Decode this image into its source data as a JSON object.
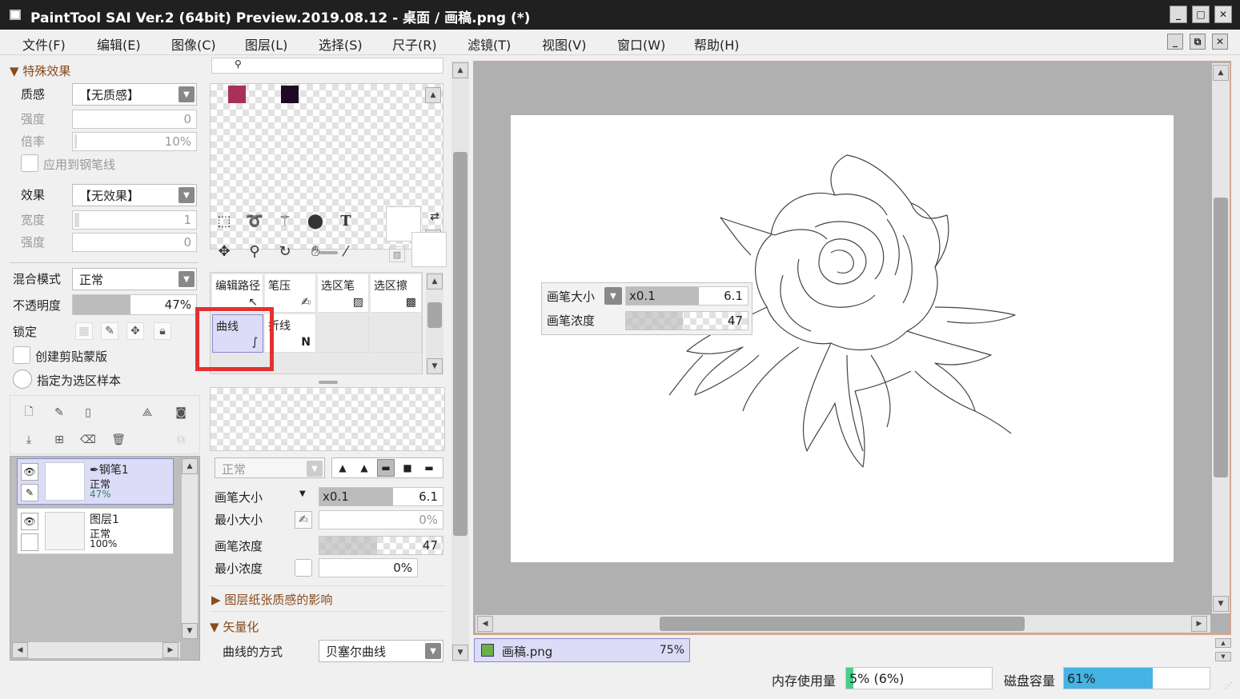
{
  "window": {
    "title": "PaintTool SAI Ver.2 (64bit) Preview.2019.08.12 - 桌面 / 画稿.png (*)",
    "minimize": "_",
    "maximize": "□",
    "close": "✕"
  },
  "menu": [
    "文件(F)",
    "编辑(E)",
    "图像(C)",
    "图层(L)",
    "选择(S)",
    "尺子(R)",
    "滤镜(T)",
    "视图(V)",
    "窗口(W)",
    "帮助(H)"
  ],
  "special_effects": {
    "header": "特殊效果",
    "texture_label": "质感",
    "texture_value": "【无质感】",
    "strength_label": "强度",
    "strength_value": "0",
    "scale_label": "倍率",
    "scale_value": "10%",
    "apply_pen": "应用到钢笔线",
    "effect_label": "效果",
    "effect_value": "【无效果】",
    "width_label": "宽度",
    "width_value": "1",
    "strength2_label": "强度",
    "strength2_value": "0"
  },
  "layer_props": {
    "blend_label": "混合模式",
    "blend_value": "正常",
    "opacity_label": "不透明度",
    "opacity_value": "47%",
    "opacity_fraction": 0.47,
    "lock_label": "锁定",
    "clip_label": "创建剪贴蒙版",
    "sample_label": "指定为选区样本"
  },
  "layers": [
    {
      "name": "钢笔1",
      "mode": "正常",
      "opacity": "47%"
    },
    {
      "name": "图层1",
      "mode": "正常",
      "opacity": "100%"
    }
  ],
  "swatches": [
    "#a8305a",
    "#1e0a24"
  ],
  "brushes": {
    "row1": [
      "编辑路径",
      "笔压",
      "选区笔",
      "选区擦"
    ],
    "row2": [
      "曲线",
      "折线"
    ]
  },
  "brush_settings": {
    "mode": "正常",
    "size_label": "画笔大小",
    "size_mult": "x0.1",
    "size_value": "6.1",
    "min_size_label": "最小大小",
    "min_size_value": "0%",
    "density_label": "画笔浓度",
    "density_value": "47",
    "min_density_label": "最小浓度",
    "min_density_value": "0%",
    "paper_label": "图层纸张质感的影响",
    "vector_label": "矢量化",
    "curve_label": "曲线的方式",
    "curve_value": "贝塞尔曲线"
  },
  "canvas_popup": {
    "size_label": "画笔大小",
    "size_mult": "x0.1",
    "size_value": "6.1",
    "density_label": "画笔浓度",
    "density_value": "47"
  },
  "document_tab": {
    "name": "画稿.png",
    "zoom": "75%"
  },
  "status": {
    "memory_label": "内存使用量",
    "memory_value": "5% (6%)",
    "memory_fraction": 0.05,
    "disk_label": "磁盘容量",
    "disk_value": "61%",
    "disk_fraction": 0.61
  },
  "colors": {
    "accent": "#e8a080",
    "selection": "#dcdcf8",
    "highlight": "#e53030",
    "disk_bar": "#44b4e4",
    "memory_bar": "#44d08c"
  }
}
